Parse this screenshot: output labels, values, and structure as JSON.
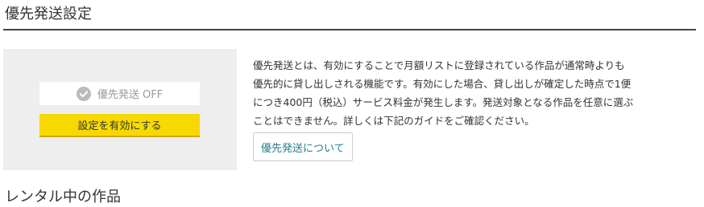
{
  "priority_shipping": {
    "title": "優先発送設定",
    "status": {
      "icon": "check-circle-icon",
      "text": "優先発送 OFF"
    },
    "enable_button_label": "設定を有効にする",
    "description_lines": [
      "優先発送とは、有効にすることで月額リストに登録されている作品が通常時よりも",
      "優先的に貸し出しされる機能です。有効にした場合、貸し出しが確定した時点で1便",
      "につき400円（税込）サービス料金が発生します。発送対象となる作品を任意に選ぶ",
      "ことはできません。詳しくは下記のガイドをご確認ください。"
    ],
    "guide_link_label": "優先発送について"
  },
  "rental": {
    "title": "レンタル中の作品"
  },
  "colors": {
    "accent_yellow": "#f7d900",
    "link_teal": "#2a7d8c",
    "panel_gray": "#eeeeee"
  }
}
